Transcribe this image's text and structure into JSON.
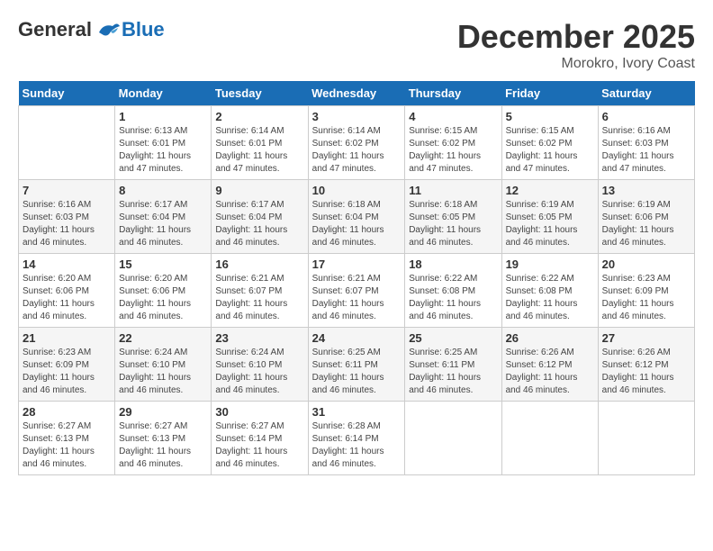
{
  "header": {
    "logo": {
      "general": "General",
      "blue": "Blue"
    },
    "title": "December 2025",
    "location": "Morokro, Ivory Coast"
  },
  "calendar": {
    "days_of_week": [
      "Sunday",
      "Monday",
      "Tuesday",
      "Wednesday",
      "Thursday",
      "Friday",
      "Saturday"
    ],
    "weeks": [
      [
        {
          "day": "",
          "info": ""
        },
        {
          "day": "1",
          "info": "Sunrise: 6:13 AM\nSunset: 6:01 PM\nDaylight: 11 hours\nand 47 minutes."
        },
        {
          "day": "2",
          "info": "Sunrise: 6:14 AM\nSunset: 6:01 PM\nDaylight: 11 hours\nand 47 minutes."
        },
        {
          "day": "3",
          "info": "Sunrise: 6:14 AM\nSunset: 6:02 PM\nDaylight: 11 hours\nand 47 minutes."
        },
        {
          "day": "4",
          "info": "Sunrise: 6:15 AM\nSunset: 6:02 PM\nDaylight: 11 hours\nand 47 minutes."
        },
        {
          "day": "5",
          "info": "Sunrise: 6:15 AM\nSunset: 6:02 PM\nDaylight: 11 hours\nand 47 minutes."
        },
        {
          "day": "6",
          "info": "Sunrise: 6:16 AM\nSunset: 6:03 PM\nDaylight: 11 hours\nand 47 minutes."
        }
      ],
      [
        {
          "day": "7",
          "info": "Sunrise: 6:16 AM\nSunset: 6:03 PM\nDaylight: 11 hours\nand 46 minutes."
        },
        {
          "day": "8",
          "info": "Sunrise: 6:17 AM\nSunset: 6:04 PM\nDaylight: 11 hours\nand 46 minutes."
        },
        {
          "day": "9",
          "info": "Sunrise: 6:17 AM\nSunset: 6:04 PM\nDaylight: 11 hours\nand 46 minutes."
        },
        {
          "day": "10",
          "info": "Sunrise: 6:18 AM\nSunset: 6:04 PM\nDaylight: 11 hours\nand 46 minutes."
        },
        {
          "day": "11",
          "info": "Sunrise: 6:18 AM\nSunset: 6:05 PM\nDaylight: 11 hours\nand 46 minutes."
        },
        {
          "day": "12",
          "info": "Sunrise: 6:19 AM\nSunset: 6:05 PM\nDaylight: 11 hours\nand 46 minutes."
        },
        {
          "day": "13",
          "info": "Sunrise: 6:19 AM\nSunset: 6:06 PM\nDaylight: 11 hours\nand 46 minutes."
        }
      ],
      [
        {
          "day": "14",
          "info": "Sunrise: 6:20 AM\nSunset: 6:06 PM\nDaylight: 11 hours\nand 46 minutes."
        },
        {
          "day": "15",
          "info": "Sunrise: 6:20 AM\nSunset: 6:06 PM\nDaylight: 11 hours\nand 46 minutes."
        },
        {
          "day": "16",
          "info": "Sunrise: 6:21 AM\nSunset: 6:07 PM\nDaylight: 11 hours\nand 46 minutes."
        },
        {
          "day": "17",
          "info": "Sunrise: 6:21 AM\nSunset: 6:07 PM\nDaylight: 11 hours\nand 46 minutes."
        },
        {
          "day": "18",
          "info": "Sunrise: 6:22 AM\nSunset: 6:08 PM\nDaylight: 11 hours\nand 46 minutes."
        },
        {
          "day": "19",
          "info": "Sunrise: 6:22 AM\nSunset: 6:08 PM\nDaylight: 11 hours\nand 46 minutes."
        },
        {
          "day": "20",
          "info": "Sunrise: 6:23 AM\nSunset: 6:09 PM\nDaylight: 11 hours\nand 46 minutes."
        }
      ],
      [
        {
          "day": "21",
          "info": "Sunrise: 6:23 AM\nSunset: 6:09 PM\nDaylight: 11 hours\nand 46 minutes."
        },
        {
          "day": "22",
          "info": "Sunrise: 6:24 AM\nSunset: 6:10 PM\nDaylight: 11 hours\nand 46 minutes."
        },
        {
          "day": "23",
          "info": "Sunrise: 6:24 AM\nSunset: 6:10 PM\nDaylight: 11 hours\nand 46 minutes."
        },
        {
          "day": "24",
          "info": "Sunrise: 6:25 AM\nSunset: 6:11 PM\nDaylight: 11 hours\nand 46 minutes."
        },
        {
          "day": "25",
          "info": "Sunrise: 6:25 AM\nSunset: 6:11 PM\nDaylight: 11 hours\nand 46 minutes."
        },
        {
          "day": "26",
          "info": "Sunrise: 6:26 AM\nSunset: 6:12 PM\nDaylight: 11 hours\nand 46 minutes."
        },
        {
          "day": "27",
          "info": "Sunrise: 6:26 AM\nSunset: 6:12 PM\nDaylight: 11 hours\nand 46 minutes."
        }
      ],
      [
        {
          "day": "28",
          "info": "Sunrise: 6:27 AM\nSunset: 6:13 PM\nDaylight: 11 hours\nand 46 minutes."
        },
        {
          "day": "29",
          "info": "Sunrise: 6:27 AM\nSunset: 6:13 PM\nDaylight: 11 hours\nand 46 minutes."
        },
        {
          "day": "30",
          "info": "Sunrise: 6:27 AM\nSunset: 6:14 PM\nDaylight: 11 hours\nand 46 minutes."
        },
        {
          "day": "31",
          "info": "Sunrise: 6:28 AM\nSunset: 6:14 PM\nDaylight: 11 hours\nand 46 minutes."
        },
        {
          "day": "",
          "info": ""
        },
        {
          "day": "",
          "info": ""
        },
        {
          "day": "",
          "info": ""
        }
      ]
    ]
  }
}
